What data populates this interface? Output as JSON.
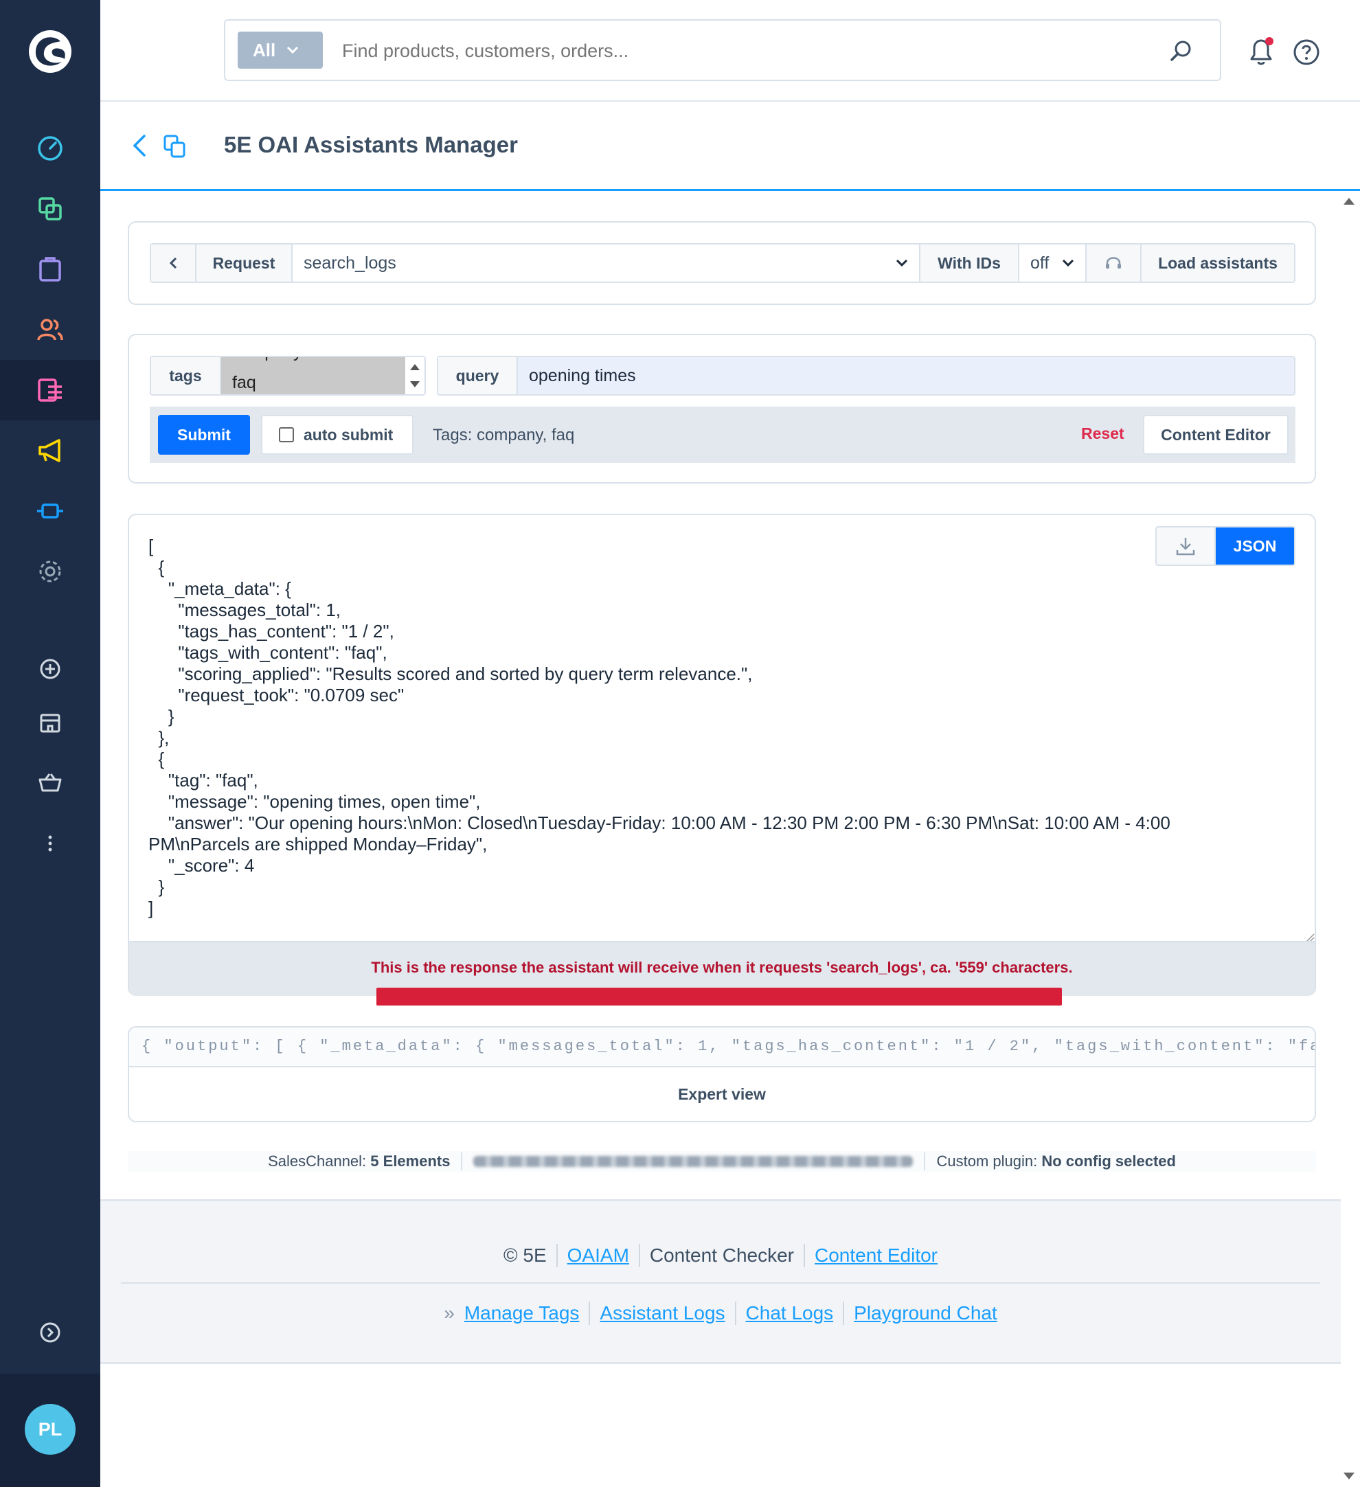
{
  "app": {
    "title": "5E OAI Assistants Manager",
    "avatar_initials": "PL"
  },
  "search": {
    "scope": "All",
    "placeholder": "Find products, customers, orders..."
  },
  "request_bar": {
    "request_label": "Request",
    "request_value": "search_logs",
    "with_ids_label": "With IDs",
    "with_ids_value": "off",
    "load_assistants_label": "Load assistants"
  },
  "form": {
    "tags_label": "tags",
    "tags_options": [
      "company",
      "faq"
    ],
    "tags_selected_visible": "faq",
    "query_label": "query",
    "query_value": "opening times",
    "submit_label": "Submit",
    "auto_submit_label": "auto submit",
    "tags_info": "Tags: company, faq",
    "reset_label": "Reset",
    "content_editor_label": "Content Editor"
  },
  "output": {
    "json_button_label": "JSON",
    "json_text": "[\n  {\n    \"_meta_data\": {\n      \"messages_total\": 1,\n      \"tags_has_content\": \"1 / 2\",\n      \"tags_with_content\": \"faq\",\n      \"scoring_applied\": \"Results scored and sorted by query term relevance.\",\n      \"request_took\": \"0.0709 sec\"\n    }\n  },\n  {\n    \"tag\": \"faq\",\n    \"message\": \"opening times, open time\",\n    \"answer\": \"Our opening hours:\\nMon: Closed\\nTuesday-Friday: 10:00 AM - 12:30 PM 2:00 PM - 6:30 PM\\nSat: 10:00 AM - 4:00 PM\\nParcels are shipped Monday–Friday\",\n    \"_score\": 4\n  }\n]",
    "message": "This is the response the assistant will receive when it requests 'search_logs', ca. '559' characters."
  },
  "expert": {
    "field_text": "{ \"output\": [ { \"_meta_data\": { \"messages_total\": 1, \"tags_has_content\": \"1 / 2\", \"tags_with_content\": \"faq\", \"scoring_applied\": \"Results scored and sorted by query term relevance.\"",
    "label": "Expert view"
  },
  "info": {
    "saleschannel_label": "SalesChannel:",
    "saleschannel_value": "5 Elements",
    "custom_plugin_label": "Custom plugin:",
    "custom_plugin_value": "No config selected"
  },
  "footer": {
    "copyright": "© 5E",
    "links_top": [
      "OAIAM",
      "Content Checker",
      "Content Editor"
    ],
    "prefix": "»",
    "links_bottom": [
      "Manage Tags",
      "Assistant Logs",
      "Chat Logs",
      "Playground Chat"
    ]
  },
  "colors": {
    "sidebar_bg": "#1d2d48",
    "primary": "#0870ff",
    "link": "#189eff",
    "error_text": "#b4122f",
    "reset": "#de294c"
  }
}
